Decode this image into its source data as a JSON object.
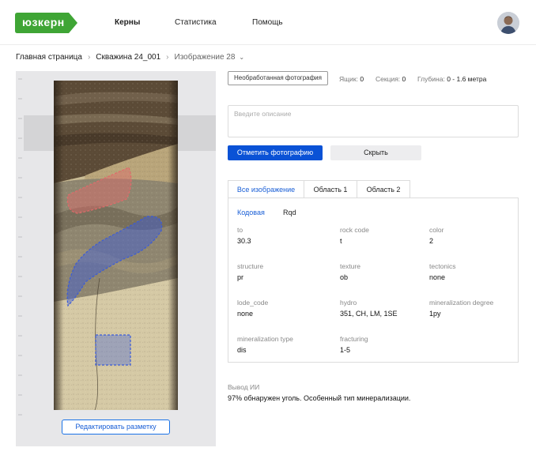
{
  "header": {
    "logo": "юзкерн",
    "nav": [
      "Керны",
      "Статистика",
      "Помощь"
    ],
    "brand_color": "#3fa535"
  },
  "breadcrumb": {
    "items": [
      "Главная страница",
      "Скважина 24_001",
      "Изображение 28"
    ]
  },
  "viewer": {
    "edit_label": "Редактировать разметку"
  },
  "meta": {
    "raw_button": "Необработанная фотография",
    "box_label": "Ящик:",
    "box_value": "0",
    "section_label": "Секция:",
    "section_value": "0",
    "depth_label": "Глубина:",
    "depth_value": "0 - 1.6 метра"
  },
  "description": {
    "placeholder": "Введите описание"
  },
  "actions": {
    "mark_label": "Отметить фотографию",
    "hide_label": "Скрыть"
  },
  "tabs": [
    "Все изображение",
    "Область 1",
    "Область 2"
  ],
  "subtabs": [
    "Кодовая",
    "Rqd"
  ],
  "props": [
    {
      "label": "to",
      "value": "30.3"
    },
    {
      "label": "rock code",
      "value": "t"
    },
    {
      "label": "color",
      "value": "2"
    },
    {
      "label": "structure",
      "value": "pr"
    },
    {
      "label": "texture",
      "value": "ob"
    },
    {
      "label": "tectonics",
      "value": "none"
    },
    {
      "label": "lode_code",
      "value": "none"
    },
    {
      "label": "hydro",
      "value": "351, CH, LM, 1SE"
    },
    {
      "label": "mineralization degree",
      "value": "1py"
    },
    {
      "label": "mineralization type",
      "value": "dis"
    },
    {
      "label": "fracturing",
      "value": "1-5"
    }
  ],
  "ai": {
    "label": "Вывод ИИ",
    "text": "97% обнаружен уголь. Особенный тип минерализации."
  },
  "colors": {
    "accent": "#0a52d6",
    "region_red": "#e06a6a",
    "region_blue": "#3a5bd9"
  }
}
